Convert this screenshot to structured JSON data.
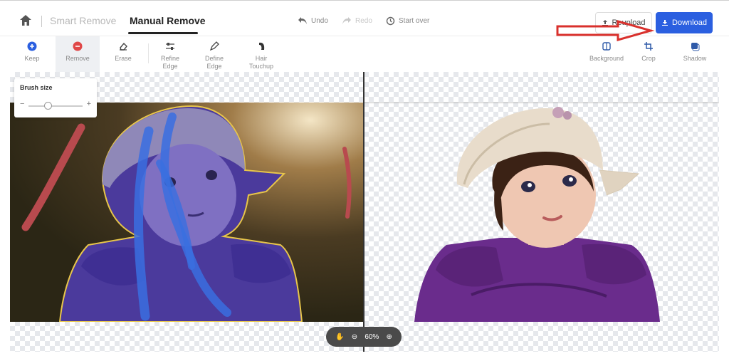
{
  "header": {
    "tabs": [
      "Smart Remove",
      "Manual Remove"
    ],
    "active_tab": "Manual Remove",
    "history": {
      "undo": "Undo",
      "redo": "Redo",
      "start_over": "Start over"
    },
    "reupload_label": "Reupload",
    "download_label": "Download"
  },
  "tools_left": [
    {
      "label": "Keep",
      "icon": "plus-circle-icon"
    },
    {
      "label": "Remove",
      "icon": "minus-circle-icon"
    },
    {
      "label": "Erase",
      "icon": "eraser-icon"
    },
    {
      "label": "Refine\nEdge",
      "icon": "sliders-icon"
    },
    {
      "label": "Define\nEdge",
      "icon": "pen-icon"
    },
    {
      "label": "Hair\nTouchup",
      "icon": "hair-icon"
    }
  ],
  "tools_right": [
    {
      "label": "Background",
      "icon": "background-icon"
    },
    {
      "label": "Crop",
      "icon": "crop-icon"
    },
    {
      "label": "Shadow",
      "icon": "shadow-icon"
    }
  ],
  "brush": {
    "label": "Brush size",
    "minus": "−",
    "plus": "+",
    "level": 0.35
  },
  "zoom": {
    "value": "60%"
  },
  "colors": {
    "accent": "#2b5fe0",
    "keep": "#2b5fe0",
    "remove": "#e04848",
    "annotation_arrow": "#d9302c"
  }
}
